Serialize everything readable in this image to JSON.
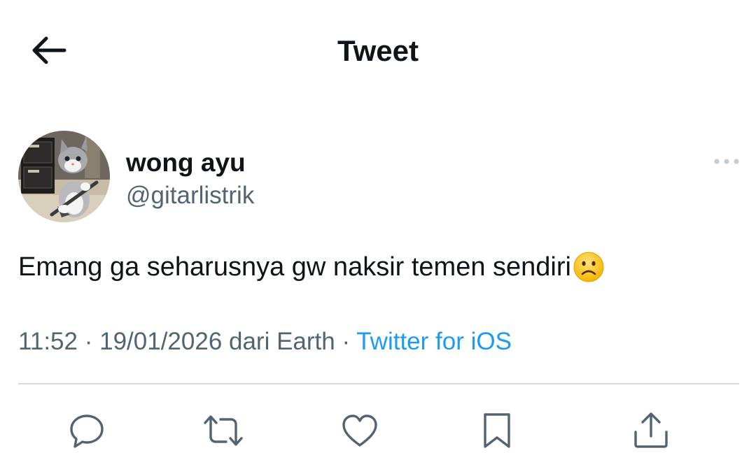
{
  "header": {
    "title": "Tweet",
    "back_icon": "arrow-left-icon"
  },
  "author": {
    "display_name": "wong ayu",
    "handle": "@gitarlistrik",
    "avatar": "kitten-with-guitar-avatar",
    "more_icon": "more-horizontal-icon"
  },
  "tweet": {
    "text": "Emang ga seharusnya gw naksir temen sendiri",
    "emoji": "frowning-face-emoji"
  },
  "meta": {
    "time": "11:52",
    "separator1": " · ",
    "date": "19/01/2026",
    "location": " dari Earth",
    "separator2": " · ",
    "source": "Twitter for iOS"
  },
  "actions": [
    {
      "name": "reply",
      "icon": "reply-icon"
    },
    {
      "name": "retweet",
      "icon": "retweet-icon"
    },
    {
      "name": "like",
      "icon": "heart-icon"
    },
    {
      "name": "bookmark",
      "icon": "bookmark-icon"
    },
    {
      "name": "share",
      "icon": "share-icon"
    }
  ],
  "colors": {
    "text_primary": "#0f1419",
    "text_secondary": "#536471",
    "link": "#1d9bf0",
    "divider": "#d4dadf"
  }
}
